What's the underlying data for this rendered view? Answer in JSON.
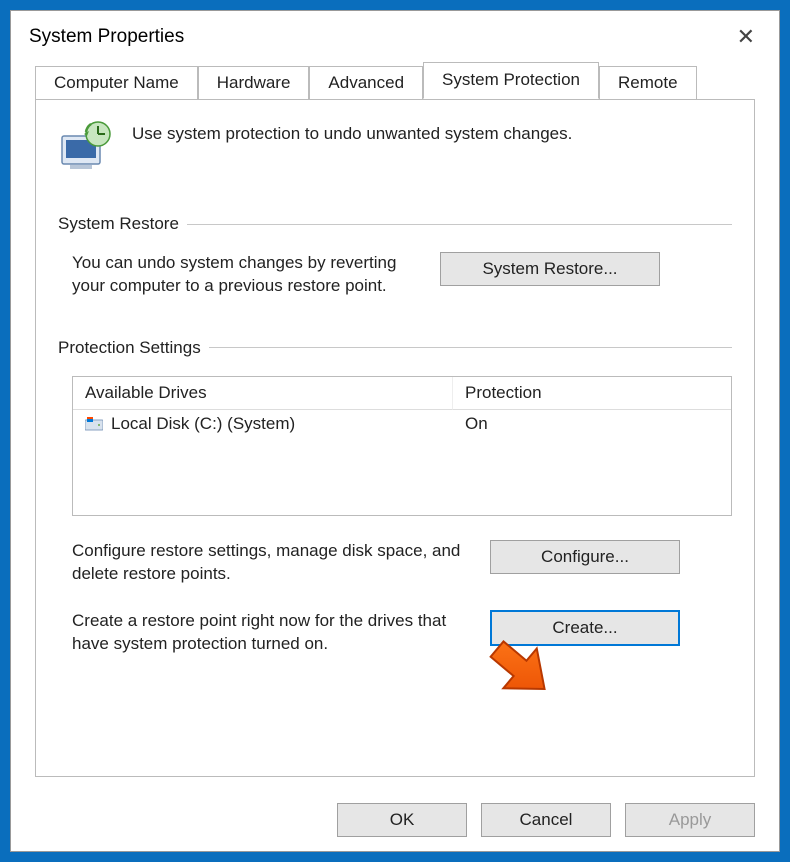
{
  "window": {
    "title": "System Properties"
  },
  "tabs": {
    "t0": "Computer Name",
    "t1": "Hardware",
    "t2": "Advanced",
    "t3": "System Protection",
    "t4": "Remote"
  },
  "intro": "Use system protection to undo unwanted system changes.",
  "sections": {
    "restore": {
      "heading": "System Restore",
      "desc": "You can undo system changes by reverting your computer to a previous restore point.",
      "button": "System Restore..."
    },
    "protection": {
      "heading": "Protection Settings",
      "col_drives": "Available Drives",
      "col_protection": "Protection",
      "drive0": {
        "name": "Local Disk (C:) (System)",
        "status": "On"
      },
      "configure": {
        "desc": "Configure restore settings, manage disk space, and delete restore points.",
        "button": "Configure..."
      },
      "create": {
        "desc": "Create a restore point right now for the drives that have system protection turned on.",
        "button": "Create..."
      }
    }
  },
  "footer": {
    "ok": "OK",
    "cancel": "Cancel",
    "apply": "Apply"
  }
}
